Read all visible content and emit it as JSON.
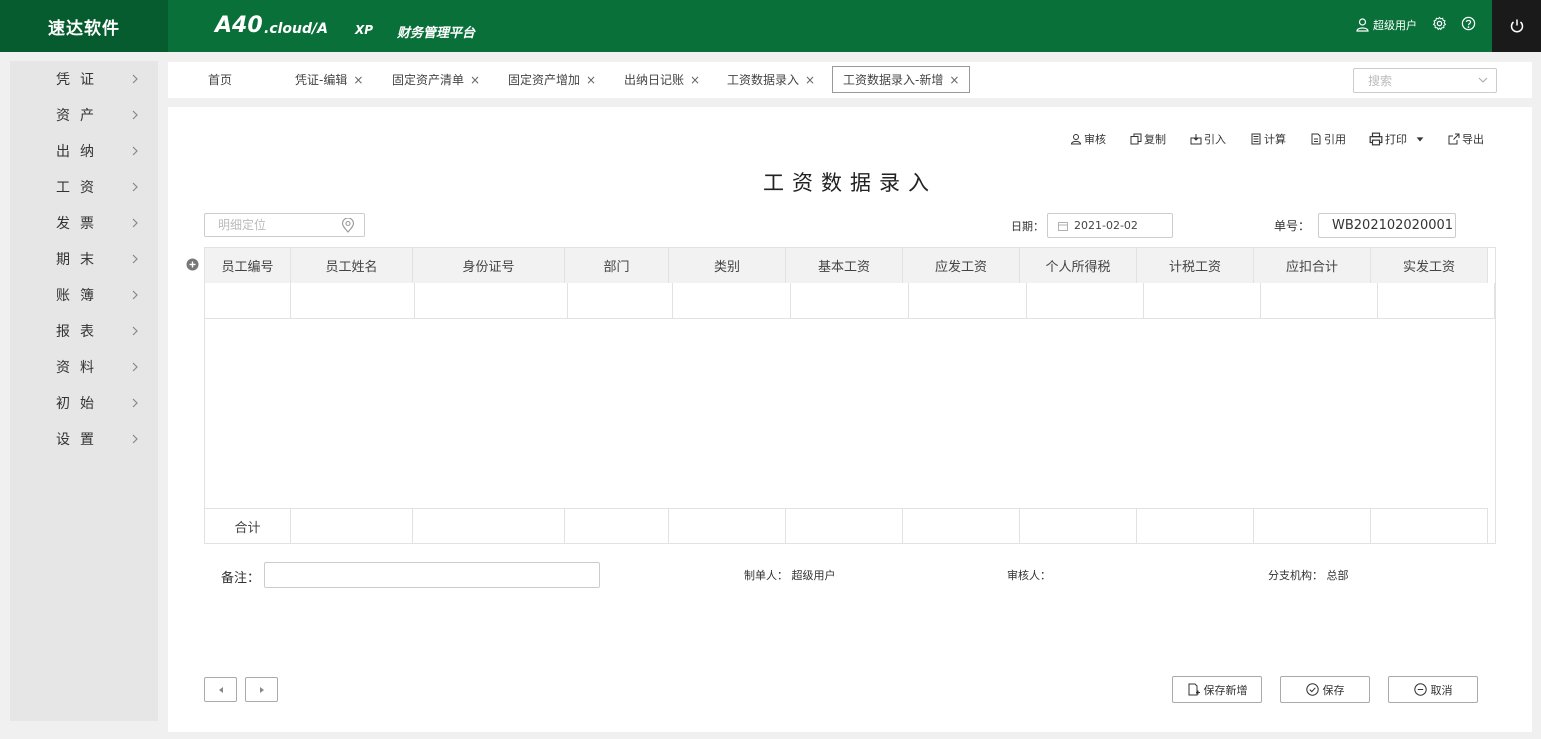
{
  "header": {
    "brand": "速达软件",
    "logo_main": "A40",
    "logo_cloud": ".cloud/A",
    "logo_xp": "XP",
    "logo_sub": "财务管理平台",
    "user": "超级用户",
    "icons": [
      "user-icon",
      "gear-icon",
      "help-icon",
      "power-icon"
    ]
  },
  "sidebar": {
    "items": [
      {
        "label": "凭证"
      },
      {
        "label": "资产"
      },
      {
        "label": "出纳"
      },
      {
        "label": "工资"
      },
      {
        "label": "发票"
      },
      {
        "label": "期末"
      },
      {
        "label": "账簿"
      },
      {
        "label": "报表"
      },
      {
        "label": "资料"
      },
      {
        "label": "初始"
      },
      {
        "label": "设置"
      }
    ]
  },
  "tabs": {
    "items": [
      {
        "label": "首页",
        "closable": false
      },
      {
        "label": "凭证-编辑",
        "closable": true
      },
      {
        "label": "固定资产清单",
        "closable": true
      },
      {
        "label": "固定资产增加",
        "closable": true
      },
      {
        "label": "出纳日记账",
        "closable": true
      },
      {
        "label": "工资数据录入",
        "closable": true
      },
      {
        "label": "工资数据录入-新增",
        "closable": true,
        "active": true
      }
    ],
    "close_glyph": "×",
    "search_placeholder": "搜索"
  },
  "toolbar": {
    "audit": "审核",
    "copy": "复制",
    "import": "引入",
    "calc": "计算",
    "reference": "引用",
    "print": "打印",
    "export": "导出"
  },
  "page": {
    "title": "工资数据录入",
    "locate_placeholder": "明细定位",
    "date_label": "日期：",
    "date_value": "2021-02-02",
    "no_label": "单号：",
    "no_value": "WB202102020001"
  },
  "grid": {
    "columns": [
      "员工编号",
      "员工姓名",
      "身份证号",
      "部门",
      "类别",
      "基本工资",
      "应发工资",
      "个人所得税",
      "计税工资",
      "应扣合计",
      "实发工资"
    ],
    "total_label": "合计"
  },
  "footer": {
    "remark_label": "备注：",
    "remark_value": "",
    "maker_label": "制单人：",
    "maker_value": "超级用户",
    "auditor_label": "审核人：",
    "auditor_value": "",
    "branch_label": "分支机构：",
    "branch_value": "总部",
    "save_new": "保存新增",
    "save": "保存",
    "cancel": "取消"
  },
  "colors": {
    "header_bg": "#0a703a",
    "brand_bg": "#075c2f",
    "power_bg": "#1a1a1a",
    "sidebar_bg": "#e6e6e6"
  }
}
